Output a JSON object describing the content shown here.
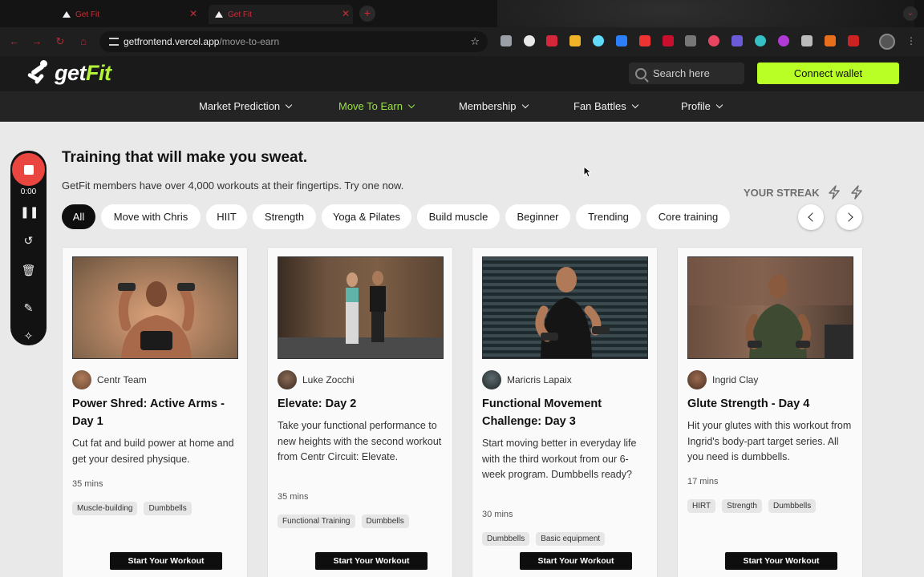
{
  "browser": {
    "tabs": [
      {
        "title": "Get Fit"
      },
      {
        "title": "Get Fit"
      }
    ],
    "url_host": "getfrontend.vercel.app",
    "url_path": "/move-to-earn"
  },
  "header": {
    "logo_get": "get",
    "logo_fit": "Fit",
    "search_placeholder": "Search here",
    "connect_label": "Connect wallet",
    "accent": "#b9ff26"
  },
  "nav": [
    {
      "label": "Market Prediction"
    },
    {
      "label": "Move To Earn",
      "active": true
    },
    {
      "label": "Membership"
    },
    {
      "label": "Fan Battles"
    },
    {
      "label": "Profile"
    }
  ],
  "recorder": {
    "time": "0:00",
    "icons": [
      "record-stop-icon",
      "pause-icon",
      "restart-icon",
      "trash-icon",
      "pen-icon",
      "magic-icon"
    ]
  },
  "main": {
    "title": "Training that will make you sweat.",
    "subtitle": "GetFit members have over 4,000 workouts at their fingertips. Try one now.",
    "streak_label": "YOUR STREAK",
    "filters": [
      "All",
      "Move with Chris",
      "HIIT",
      "Strength",
      "Yoga & Pilates",
      "Build muscle",
      "Beginner",
      "Trending",
      "Core training"
    ]
  },
  "cards": [
    {
      "author": "Centr Team",
      "title": "Power Shred: Active Arms - Day 1",
      "description": "Cut fat and build power at home and get your desired physique.",
      "duration": "35 mins",
      "tags": [
        "Muscle-building",
        "Dumbbells"
      ],
      "button": "Start Your Workout"
    },
    {
      "author": "Luke Zocchi",
      "title": "Elevate: Day 2",
      "description": "Take your functional performance to new heights with the second workout from Centr Circuit: Elevate.",
      "duration": "35 mins",
      "tags": [
        "Functional Training",
        "Dumbbells"
      ],
      "button": "Start Your Workout"
    },
    {
      "author": "Maricris Lapaix",
      "title": "Functional Movement Challenge: Day 3",
      "description": "Start moving better in everyday life with the third workout from our 6-week program. Dumbbells ready?",
      "duration": "30 mins",
      "tags": [
        "Dumbbells",
        "Basic equipment"
      ],
      "button": "Start Your Workout"
    },
    {
      "author": "Ingrid Clay",
      "title": "Glute Strength - Day 4",
      "description": "Hit your glutes with this workout from Ingrid's body-part target series. All you need is dumbbells.",
      "duration": "17 mins",
      "tags": [
        "HIRT",
        "Strength",
        "Dumbbells"
      ],
      "button": "Start Your Workout"
    }
  ]
}
